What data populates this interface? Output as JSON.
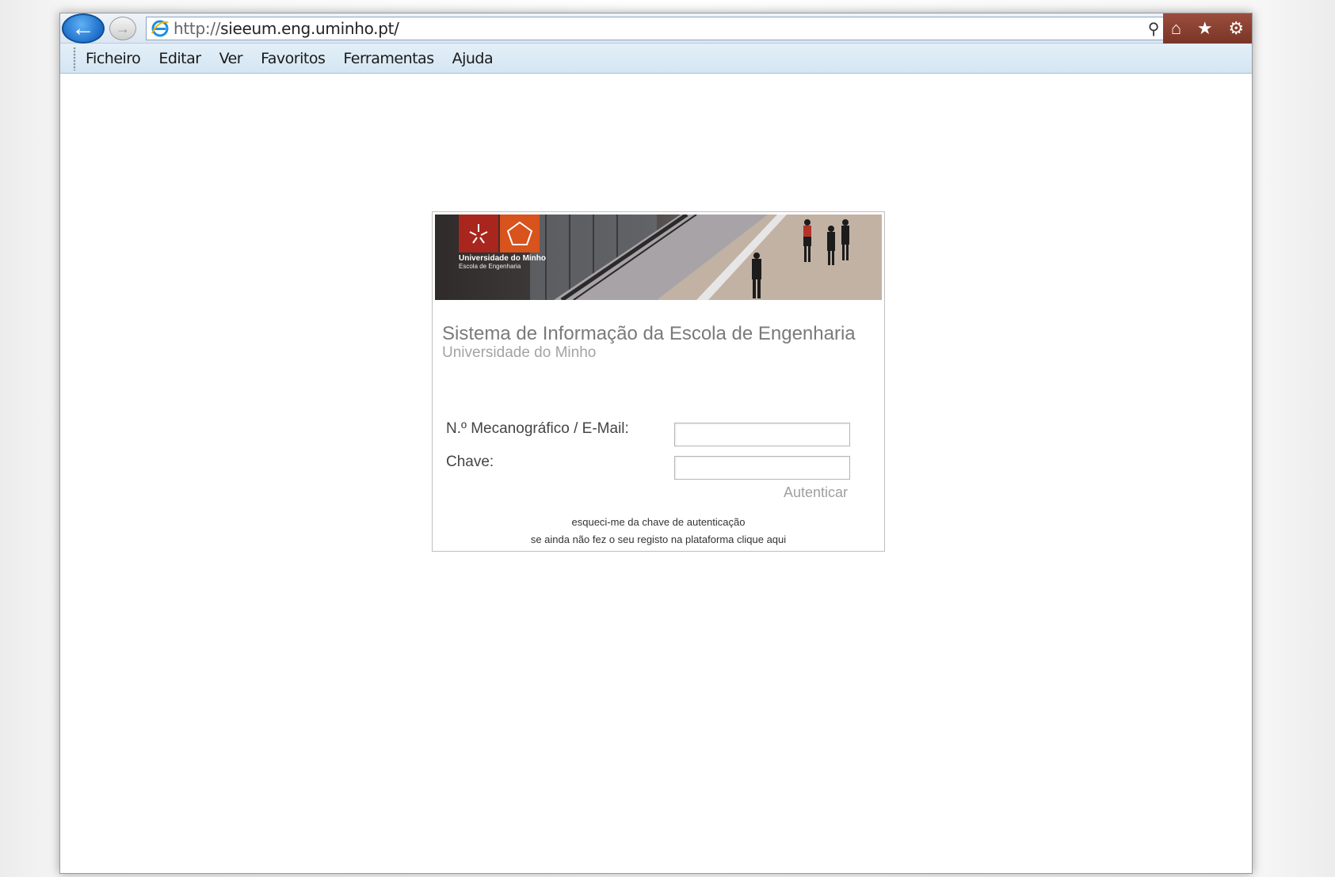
{
  "browser": {
    "url_protocol": "http://",
    "url_host": "sieeum.eng.uminho.pt/",
    "menu": [
      "Ficheiro",
      "Editar",
      "Ver",
      "Favoritos",
      "Ferramentas",
      "Ajuda"
    ]
  },
  "banner": {
    "logo_line1": "Universidade do Minho",
    "logo_line2": "Escola de Engenharia"
  },
  "login": {
    "title": "Sistema de Informação da Escola de Engenharia",
    "subtitle": "Universidade do Minho",
    "user_label": "N.º Mecanográfico / E-Mail:",
    "user_value": "",
    "password_label": "Chave:",
    "password_value": "",
    "submit_label": "Autenticar",
    "forgot_link": "esqueci-me da chave de autenticação",
    "register_link": "se ainda não fez o seu registo na plataforma clique aqui"
  },
  "colors": {
    "logo_red": "#a8261d",
    "logo_orange": "#d9531c",
    "ie_back_blue": "#1e6fc9"
  }
}
